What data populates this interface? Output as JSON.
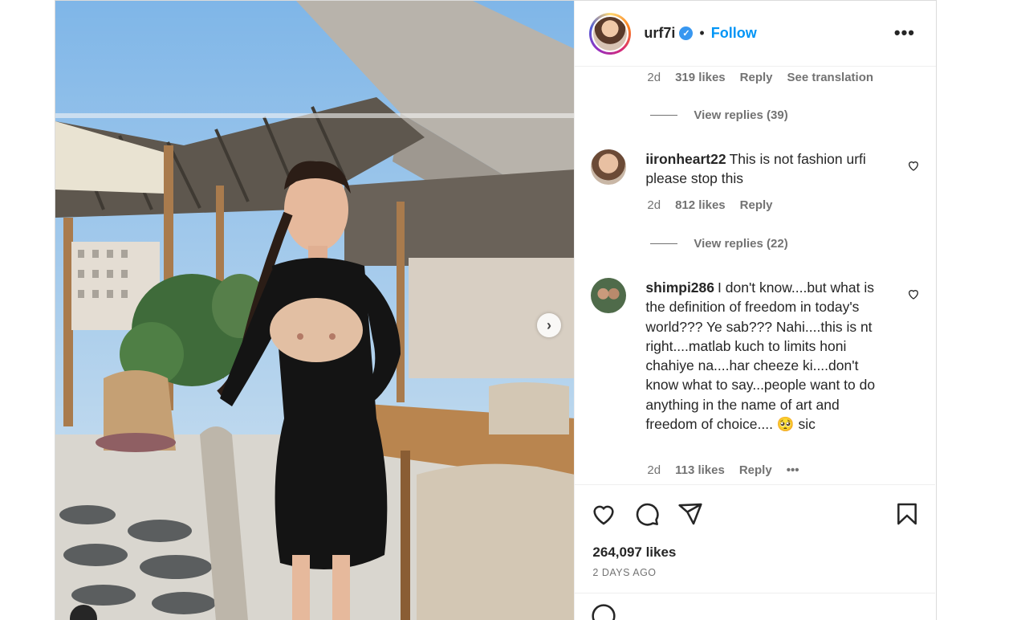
{
  "header": {
    "username": "urf7i",
    "verified_icon": "verified-badge-icon",
    "separator": "•",
    "follow_label": "Follow",
    "more_icon": "more-options-icon"
  },
  "comments_top": {
    "time": "2d",
    "likes": "319 likes",
    "reply": "Reply",
    "translate": "See translation"
  },
  "replies_1": {
    "label": "View replies (39)"
  },
  "comment_1": {
    "user": "iironheart22",
    "text": "This is not fashion urfi please stop this",
    "time": "2d",
    "likes": "812 likes",
    "reply": "Reply"
  },
  "replies_2": {
    "label": "View replies (22)"
  },
  "comment_2": {
    "user": "shimpi286",
    "text": "I don't know....but what is the definition of freedom in today's world??? Ye sab??? Nahi....this is nt right....matlab kuch to limits honi chahiye na....har cheeze ki....don't know what to say...people want to do anything in the name of art and freedom of choice.... 🥺 sic",
    "time": "2d",
    "likes": "113 likes",
    "reply": "Reply",
    "more": "•••"
  },
  "footer": {
    "likes": "264,097 likes",
    "time": "2 DAYS AGO"
  },
  "colors": {
    "accent": "#0095f6",
    "muted": "#737373",
    "text": "#262626"
  }
}
